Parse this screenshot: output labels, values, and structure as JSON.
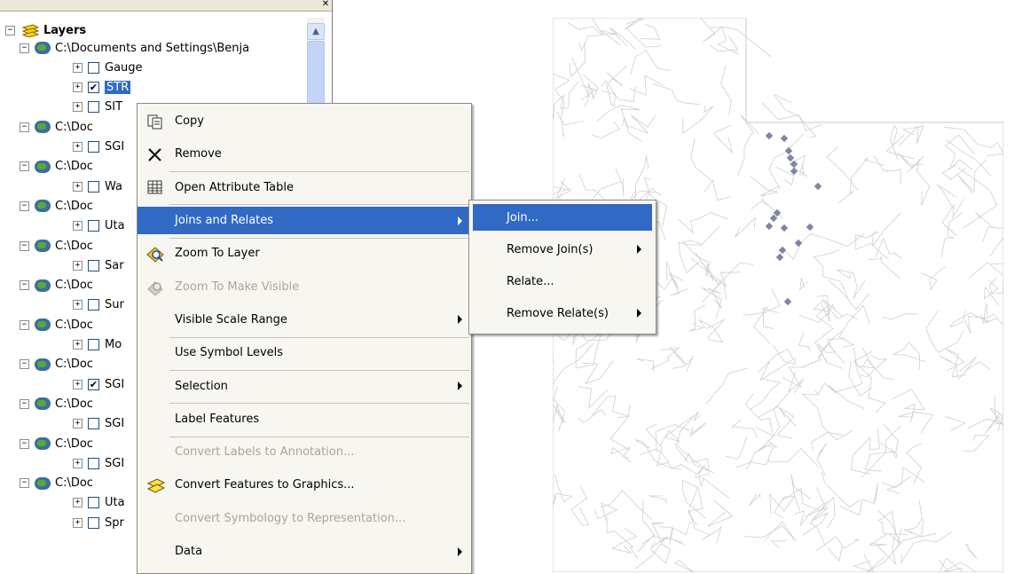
{
  "toc": {
    "root_label": "Layers",
    "rows": [
      {
        "kind": "group",
        "label": "C:\\Documents and Settings\\Benja"
      },
      {
        "kind": "layer",
        "label": "Gauge",
        "checked": false
      },
      {
        "kind": "layer",
        "label": "STR",
        "checked": true,
        "selected": true
      },
      {
        "kind": "layer",
        "label": "SIT",
        "checked": false
      },
      {
        "kind": "group",
        "label": "C:\\Doc"
      },
      {
        "kind": "layer",
        "label": "SGI",
        "checked": false
      },
      {
        "kind": "group",
        "label": "C:\\Doc"
      },
      {
        "kind": "layer",
        "label": "Wa",
        "checked": false
      },
      {
        "kind": "group",
        "label": "C:\\Doc"
      },
      {
        "kind": "layer",
        "label": "Uta",
        "checked": false
      },
      {
        "kind": "group",
        "label": "C:\\Doc"
      },
      {
        "kind": "layer",
        "label": "Sar",
        "checked": false
      },
      {
        "kind": "group",
        "label": "C:\\Doc"
      },
      {
        "kind": "layer",
        "label": "Sur",
        "checked": false
      },
      {
        "kind": "group",
        "label": "C:\\Doc"
      },
      {
        "kind": "layer",
        "label": "Mo",
        "checked": false
      },
      {
        "kind": "group",
        "label": "C:\\Doc"
      },
      {
        "kind": "layer",
        "label": "SGI",
        "checked": true
      },
      {
        "kind": "group",
        "label": "C:\\Doc"
      },
      {
        "kind": "layer",
        "label": "SGI",
        "checked": false
      },
      {
        "kind": "group",
        "label": "C:\\Doc"
      },
      {
        "kind": "layer",
        "label": "SGI",
        "checked": false
      },
      {
        "kind": "group",
        "label": "C:\\Doc"
      },
      {
        "kind": "layer",
        "label": "Uta",
        "checked": false
      },
      {
        "kind": "layer",
        "label": "Spr",
        "checked": false
      }
    ]
  },
  "context_menu": {
    "items": [
      {
        "label": "Copy",
        "icon": "copy-icon",
        "enabled": true
      },
      {
        "label": "Remove",
        "icon": "remove-x-icon",
        "enabled": true
      },
      {
        "label": "Open Attribute Table",
        "icon": "table-icon",
        "enabled": true
      },
      {
        "label": "Joins and Relates",
        "icon": "",
        "enabled": true,
        "submenu": true,
        "highlighted": true
      },
      {
        "label": "Zoom To Layer",
        "icon": "zoom-to-layer-icon",
        "enabled": true
      },
      {
        "label": "Zoom To Make Visible",
        "icon": "zoom-visible-icon",
        "enabled": false
      },
      {
        "label": "Visible Scale Range",
        "icon": "",
        "enabled": true,
        "submenu": true
      },
      {
        "label": "Use Symbol Levels",
        "icon": "",
        "enabled": true
      },
      {
        "label": "Selection",
        "icon": "",
        "enabled": true,
        "submenu": true
      },
      {
        "label": "Label Features",
        "icon": "",
        "enabled": true
      },
      {
        "label": "Convert Labels to Annotation...",
        "icon": "",
        "enabled": false
      },
      {
        "label": "Convert Features to Graphics...",
        "icon": "convert-graphics-icon",
        "enabled": true
      },
      {
        "label": "Convert Symbology to Representation...",
        "icon": "",
        "enabled": false
      },
      {
        "label": "Data",
        "icon": "",
        "enabled": true,
        "submenu": true
      }
    ]
  },
  "submenu": {
    "items": [
      {
        "label": "Join...",
        "highlighted": true,
        "submenu": false
      },
      {
        "label": "Remove Join(s)",
        "submenu": true
      },
      {
        "label": "Relate...",
        "submenu": false
      },
      {
        "label": "Remove Relate(s)",
        "submenu": true
      }
    ]
  },
  "map": {
    "point_color": "#7f86a4"
  },
  "colors": {
    "highlight": "#316ac5",
    "menu_bg": "#f7f6f1",
    "disabled_text": "#a7a59d"
  }
}
